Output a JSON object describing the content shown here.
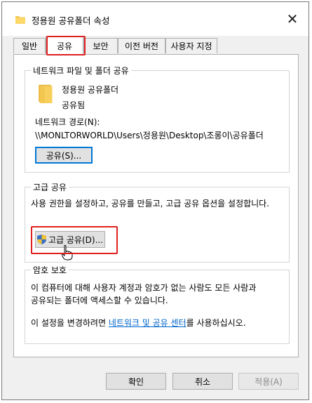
{
  "window": {
    "title": "정용원 공유폴더 속성",
    "close_glyph": "✕"
  },
  "tabs": [
    {
      "label": "일반"
    },
    {
      "label": "공유",
      "active": true
    },
    {
      "label": "보안"
    },
    {
      "label": "이전 버전"
    },
    {
      "label": "사용자 지정"
    }
  ],
  "network_sharing": {
    "group_title": "네트워크 파일 및 폴더 공유",
    "folder_name": "정용원 공유폴더",
    "status": "공유됨",
    "path_label": "네트워크 경로(N):",
    "path_value": "\\\\MONLTORWORLD\\Users\\정용원\\Desktop\\조롱이\\공유폴더",
    "share_button": "공유(S)..."
  },
  "advanced_sharing": {
    "group_title": "고급 공유",
    "description": "사용 권한을 설정하고, 공유를 만들고, 고급 공유 옵션을 설정합니다.",
    "button": "고급 공유(D)..."
  },
  "password_protection": {
    "group_title": "암호 보호",
    "description_line1": "이 컴퓨터에 대해 사용자 계정과 암호가 없는 사람도 모든 사람과",
    "description_line2": "공유되는 폴더에 액세스할 수 있습니다.",
    "change_prefix": "이 설정을 변경하려면 ",
    "change_link": "네트워크 및 공유 센터",
    "change_suffix": "를 사용하십시오."
  },
  "footer": {
    "ok": "확인",
    "cancel": "취소",
    "apply": "적용(A)"
  },
  "colors": {
    "highlight_box": "#e02020",
    "link": "#0066cc",
    "focus": "#0078d7",
    "folder": "#f3c64f"
  }
}
